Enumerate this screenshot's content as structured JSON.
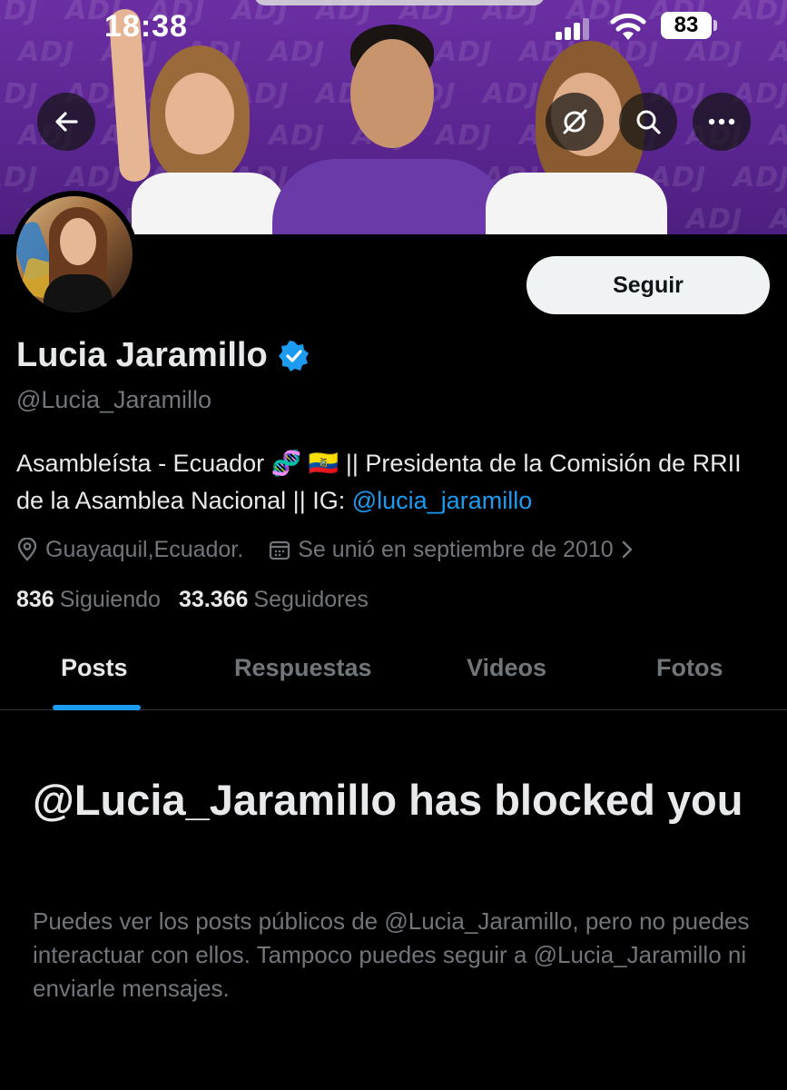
{
  "status_bar": {
    "time": "18:38",
    "battery": "83"
  },
  "banner": {
    "pattern_text": "ADJ"
  },
  "profile": {
    "name": "Lucia Jaramillo",
    "handle": "@Lucia_Jaramillo",
    "follow_label": "Seguir",
    "bio_text": "Asambleísta - Ecuador 🧬 🇪🇨 || Presidenta de la Comisión de RRII de la Asamblea Nacional || IG: ",
    "bio_link": "@lucia_jaramillo",
    "location": "Guayaquil,Ecuador.",
    "joined": "Se unió en septiembre de 2010",
    "following_count": "836",
    "following_label": "Siguiendo",
    "followers_count": "33.366",
    "followers_label": "Seguidores"
  },
  "tabs": [
    {
      "label": "Posts",
      "active": true
    },
    {
      "label": "Respuestas",
      "active": false
    },
    {
      "label": "Videos",
      "active": false
    },
    {
      "label": "Fotos",
      "active": false
    }
  ],
  "blocked": {
    "title": "@Lucia_Jaramillo has blocked you",
    "message": "Puedes ver los posts públicos de @Lucia_Jaramillo, pero no puedes interactuar con ellos. Tampoco puedes seguir a @Lucia_Jaramillo ni enviarle mensajes."
  },
  "colors": {
    "accent": "#1d9bf0",
    "banner_purple": "#5a2590",
    "background": "#000000"
  }
}
